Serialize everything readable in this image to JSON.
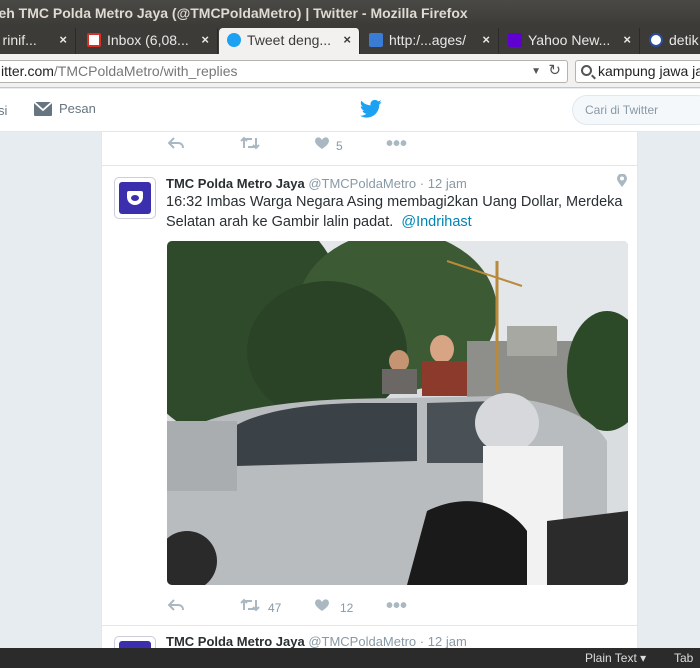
{
  "window": {
    "title": "oleh TMC Polda Metro Jaya (@TMCPoldaMetro) | Twitter - Mozilla Firefox"
  },
  "tabs": [
    {
      "label": "- rinif...",
      "close": "×"
    },
    {
      "label": "Inbox (6,08...",
      "close": "×"
    },
    {
      "label": "Tweet deng...",
      "close": "×"
    },
    {
      "label": "http:/...ages/",
      "close": "×"
    },
    {
      "label": "Yahoo New...",
      "close": "×"
    },
    {
      "label": "detik",
      "close": ""
    }
  ],
  "addressbar": {
    "host": "itter.com",
    "path": "/TMCPoldaMetro/with_replies"
  },
  "searchbar": {
    "value": "kampung jawa ja"
  },
  "twitter_nav": {
    "fragment": "si",
    "messages": "Pesan",
    "search_placeholder": "Cari di Twitter"
  },
  "prev_tweet": {
    "likes": "5"
  },
  "tweet": {
    "name": "TMC Polda Metro Jaya",
    "handle": "@TMCPoldaMetro",
    "time": "12 jam",
    "text": "16:32 Imbas Warga Negara Asing membagi2kan Uang Dollar, Merdeka Selatan arah ke Gambir lalin padat.",
    "mention": "@Indrihast",
    "retweets": "47",
    "likes": "12"
  },
  "next_tweet": {
    "name": "TMC Polda Metro Jaya",
    "handle": "@TMCPoldaMetro",
    "time": "12 jam"
  },
  "statusbar": {
    "plain_text": "Plain Text ▾",
    "tab": "Tab"
  },
  "colors": {
    "twitter_blue": "#1da1f2",
    "link": "#0084b4",
    "chrome_dark": "#3c3b37"
  }
}
